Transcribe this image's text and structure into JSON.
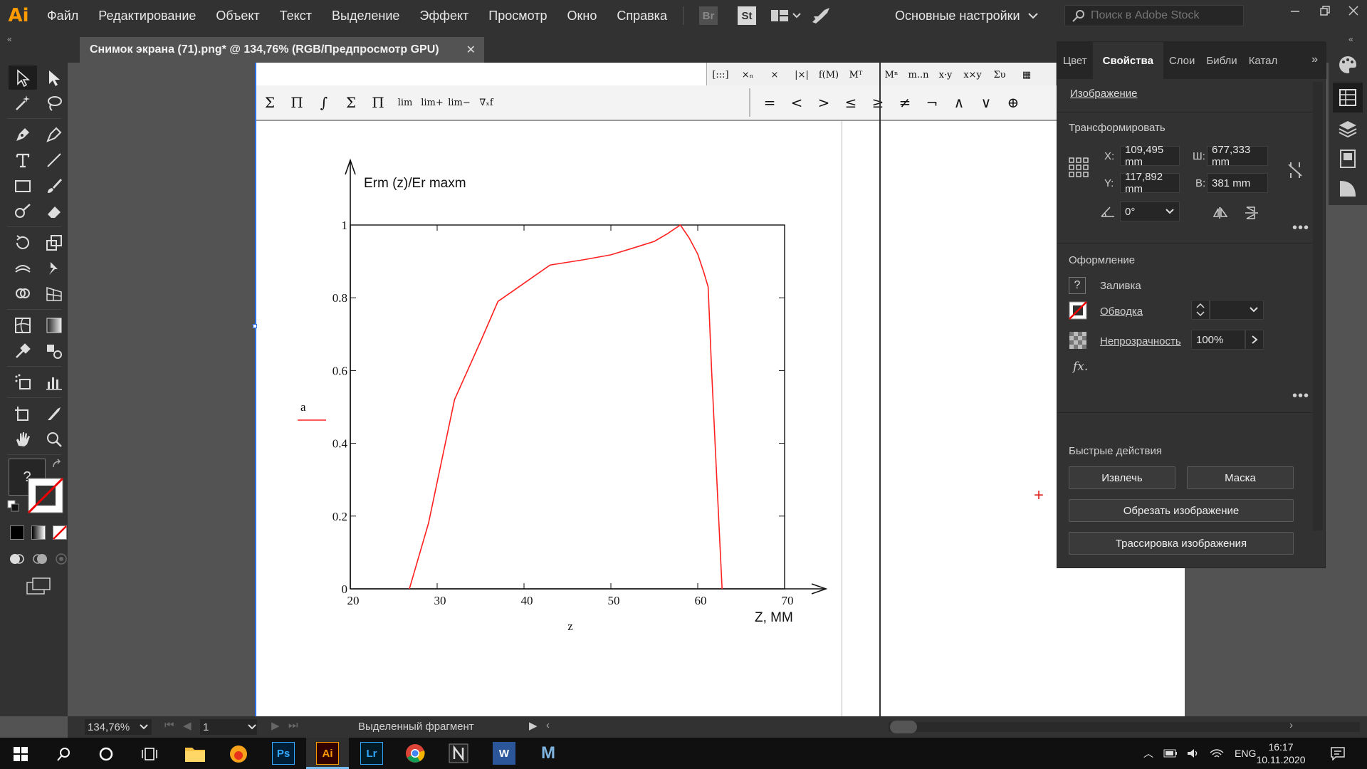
{
  "app": {
    "logo": "Ai",
    "window_title": "Снимок экрана (71).png* @ 134,76% (RGB/Предпросмотр GPU)"
  },
  "menu": [
    "Файл",
    "Редактирование",
    "Объект",
    "Текст",
    "Выделение",
    "Эффект",
    "Просмотр",
    "Окно",
    "Справка"
  ],
  "toolbar_badges": {
    "br": "Br",
    "st": "St"
  },
  "workspace": {
    "label": "Основные настройки"
  },
  "search": {
    "placeholder": "Поиск в Adobe Stock"
  },
  "fill_box": {
    "symbol": "?"
  },
  "math": {
    "top_row": [
      "[:::]",
      "×ₙ",
      "×",
      "|×|",
      "f(M)",
      "Mᵀ",
      "Mⁿ",
      "m..n",
      "x·y",
      "x×y",
      "Συ",
      "▦"
    ],
    "row": [
      "Σ",
      "Π",
      "∫",
      "Σ",
      "Π",
      "lim",
      "lim+",
      "lim−",
      "∇ₓf"
    ],
    "ops": [
      "=",
      "<",
      ">",
      "≤",
      "≥",
      "≠",
      "¬",
      "∧",
      "∨",
      "⊕"
    ]
  },
  "chart_data": {
    "type": "line",
    "annotation": "Erm (z)/Er maxm",
    "xlabel_bottom": "z",
    "xlabel_right": "Z, MM",
    "legend_entry": "a",
    "x_ticks": [
      20,
      30,
      40,
      50,
      60,
      70
    ],
    "y_ticks": [
      "0",
      "0.2",
      "0.4",
      "0.6",
      "0.8",
      "1"
    ],
    "xlim": [
      20,
      70
    ],
    "ylim": [
      0,
      1
    ],
    "grid": false,
    "series": [
      {
        "color": "#ff2020",
        "x": [
          26.8,
          29.0,
          32.0,
          35.0,
          37.0,
          40.0,
          43.0,
          47.0,
          50.0,
          53.0,
          55.0,
          56.5,
          58.0,
          59.0,
          60.0,
          60.7,
          61.2,
          61.6,
          62.2,
          62.8
        ],
        "y": [
          0.0,
          0.18,
          0.52,
          0.68,
          0.79,
          0.84,
          0.89,
          0.905,
          0.918,
          0.94,
          0.955,
          0.976,
          1.0,
          0.965,
          0.92,
          0.87,
          0.83,
          0.6,
          0.3,
          0.0
        ]
      }
    ]
  },
  "properties": {
    "tabs": [
      "Цвет",
      "Свойства",
      "Слои",
      "Библи",
      "Катал"
    ],
    "object_type": "Изображение",
    "transform": {
      "title": "Трансформировать",
      "x_label": "X:",
      "x": "109,495 mm",
      "y_label": "Y:",
      "y": "117,892 mm",
      "w_label": "Ш:",
      "w": "677,333 mm",
      "h_label": "В:",
      "h": "381 mm",
      "angle": "0°"
    },
    "appearance": {
      "title": "Оформление",
      "fill": "Заливка",
      "fill_symbol": "?",
      "stroke": "Обводка",
      "opacity_label": "Непрозрачность",
      "opacity": "100%",
      "fx": "fx."
    },
    "quick_actions": {
      "title": "Быстрые действия",
      "extract": "Извлечь",
      "mask": "Маска",
      "crop": "Обрезать изображение",
      "trace": "Трассировка изображения"
    }
  },
  "status": {
    "zoom": "134,76%",
    "page": "1",
    "selection": "Выделенный фрагмент"
  },
  "taskbar": {
    "lang": "ENG",
    "time": "16:17",
    "date": "10.11.2020",
    "apps": [
      "Ps",
      "Ai",
      "Lr",
      "W",
      "M"
    ]
  },
  "colors": {
    "accent_ai": "#ff9a00",
    "chart_line": "#ff2020",
    "panel_bg": "#323232",
    "canvas_bg": "#535353"
  }
}
